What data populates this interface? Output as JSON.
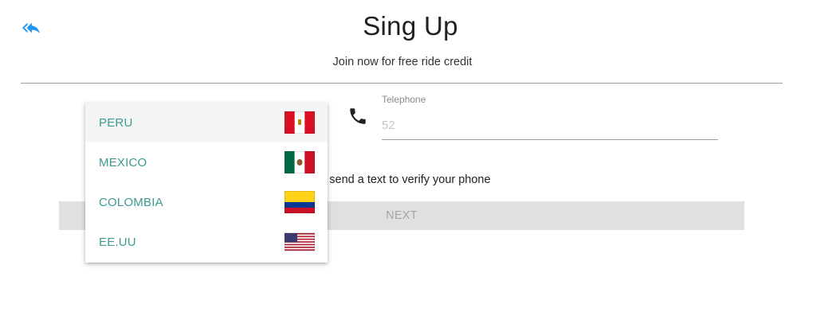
{
  "header": {
    "title": "Sing Up",
    "subtitle": "Join now for free ride credit"
  },
  "icons": {
    "back": "reply-all-icon",
    "phone": "phone-icon"
  },
  "telephone": {
    "label": "Telephone",
    "value": "",
    "placeholder": "52"
  },
  "verify_text": "send a text to verify your phone",
  "next_button": "NEXT",
  "country_dropdown": {
    "items": [
      {
        "label": "PERU",
        "flag": "peru-flag-icon",
        "selected": true
      },
      {
        "label": "MEXICO",
        "flag": "mexico-flag-icon",
        "selected": false
      },
      {
        "label": "COLOMBIA",
        "flag": "colombia-flag-icon",
        "selected": false
      },
      {
        "label": "EE.UU",
        "flag": "usa-flag-icon",
        "selected": false
      }
    ]
  },
  "colors": {
    "accent": "#2196f3",
    "item_text": "#3c9a90",
    "button_bg": "#e0e0e0",
    "button_text": "#a6a6a6"
  }
}
